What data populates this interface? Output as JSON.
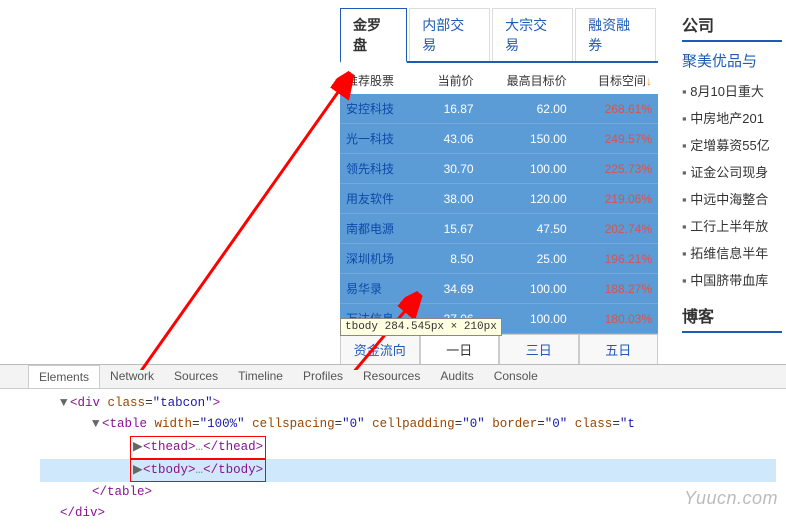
{
  "tabs": {
    "items": [
      "金罗盘",
      "内部交易",
      "大宗交易",
      "融资融券"
    ],
    "active_index": 0
  },
  "table": {
    "headers": [
      "推荐股票",
      "当前价",
      "最高目标价",
      "目标空间"
    ],
    "sort_indicator": "↓",
    "rows": [
      {
        "name": "安控科技",
        "price": "16.87",
        "target": "62.00",
        "pct": "268.61%"
      },
      {
        "name": "光一科技",
        "price": "43.06",
        "target": "150.00",
        "pct": "249.57%"
      },
      {
        "name": "领先科技",
        "price": "30.70",
        "target": "100.00",
        "pct": "225.73%"
      },
      {
        "name": "用友软件",
        "price": "38.00",
        "target": "120.00",
        "pct": "219.06%"
      },
      {
        "name": "南都电源",
        "price": "15.67",
        "target": "47.50",
        "pct": "202.74%"
      },
      {
        "name": "深圳机场",
        "price": "8.50",
        "target": "25.00",
        "pct": "196.21%"
      },
      {
        "name": "易华录",
        "price": "34.69",
        "target": "100.00",
        "pct": "188.27%"
      },
      {
        "name": "万达信息",
        "price": "37.06",
        "target": "100.00",
        "pct": "180.03%"
      }
    ]
  },
  "tooltip": "tbody 284.545px × 210px",
  "tabs2": {
    "items": [
      "资金流向",
      "一日",
      "三日",
      "五日"
    ],
    "active_index": 1
  },
  "right": {
    "section_title": "公司",
    "headline": "聚美优品与",
    "news": [
      "8月10日重大",
      "中房地产201",
      "定增募资55亿",
      "证金公司现身",
      "中远中海整合",
      "工行上半年放",
      "拓维信息半年",
      "中国脐带血库"
    ],
    "blog_title": "博客"
  },
  "devtools": {
    "tabs": [
      "Elements",
      "Network",
      "Sources",
      "Timeline",
      "Profiles",
      "Resources",
      "Audits",
      "Console"
    ],
    "active_index": 0,
    "code": {
      "div_open": "<div class=\"tabcon\">",
      "table_open": "<table width=\"100%\" cellspacing=\"0\" cellpadding=\"0\" border=\"0\" class=\"t",
      "thead": "<thead>…</thead>",
      "tbody": "<tbody>…</tbody>",
      "table_close": "</table>",
      "div_close": "</div>"
    }
  },
  "watermark": "Yuucn.com"
}
